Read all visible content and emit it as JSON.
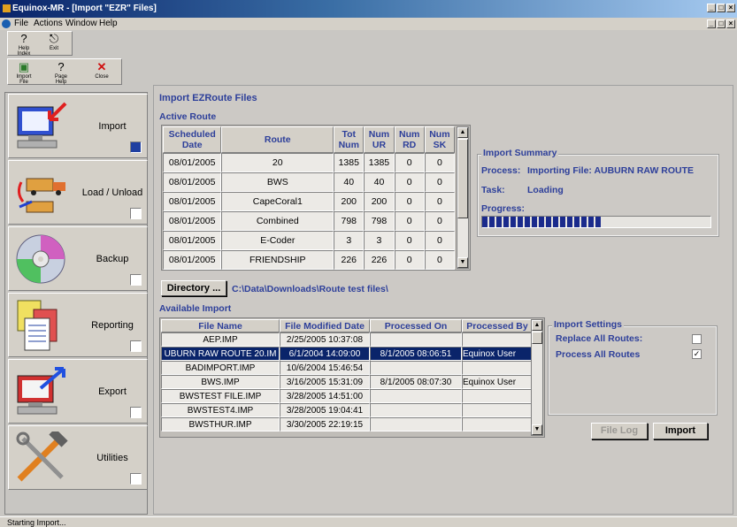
{
  "window": {
    "title": "Equinox-MR - [Import \"EZR\" Files]"
  },
  "menu": {
    "file": "File",
    "actions": "Actions",
    "window": "Window",
    "help": "Help"
  },
  "toolbar1": {
    "help_index": "Help Index",
    "exit": "Exit"
  },
  "toolbar2": {
    "import_file": "Import File",
    "page_help": "Page Help",
    "close": "Close"
  },
  "sidebar": {
    "items": [
      {
        "label": "Import",
        "checked": true
      },
      {
        "label": "Load / Unload",
        "checked": false
      },
      {
        "label": "Backup",
        "checked": false
      },
      {
        "label": "Reporting",
        "checked": false
      },
      {
        "label": "Export",
        "checked": false
      },
      {
        "label": "Utilities",
        "checked": false
      }
    ]
  },
  "main": {
    "heading": "Import EZRoute Files",
    "active_route_label": "Active Route",
    "routes_headers": {
      "scheduled_date": "Scheduled Date",
      "route": "Route",
      "tot_num": "Tot Num",
      "num_ur": "Num UR",
      "num_rd": "Num RD",
      "num_sk": "Num SK"
    },
    "routes": [
      {
        "date": "08/01/2005",
        "route": "20",
        "tot": "1385",
        "ur": "1385",
        "rd": "0",
        "sk": "0"
      },
      {
        "date": "08/01/2005",
        "route": "BWS",
        "tot": "40",
        "ur": "40",
        "rd": "0",
        "sk": "0"
      },
      {
        "date": "08/01/2005",
        "route": "CapeCoral1",
        "tot": "200",
        "ur": "200",
        "rd": "0",
        "sk": "0"
      },
      {
        "date": "08/01/2005",
        "route": "Combined",
        "tot": "798",
        "ur": "798",
        "rd": "0",
        "sk": "0"
      },
      {
        "date": "08/01/2005",
        "route": "E-Coder",
        "tot": "3",
        "ur": "3",
        "rd": "0",
        "sk": "0"
      },
      {
        "date": "08/01/2005",
        "route": "FRIENDSHIP",
        "tot": "226",
        "ur": "226",
        "rd": "0",
        "sk": "0"
      }
    ],
    "summary": {
      "title": "Import Summary",
      "process_label": "Process:",
      "process_value": "Importing File: AUBURN RAW ROUTE",
      "task_label": "Task:",
      "task_value": "Loading",
      "progress_label": "Progress:",
      "progress_fraction": 0.52
    },
    "directory_button": "Directory ...",
    "directory_path": "C:\\Data\\Downloads\\Route test files\\",
    "available_label": "Available Import",
    "files_headers": {
      "file_name": "File Name",
      "modified": "File Modified Date",
      "processed_on": "Processed On",
      "processed_by": "Processed By"
    },
    "files": [
      {
        "name": "AEP.IMP",
        "modified": "2/25/2005 10:37:08",
        "processed_on": "",
        "processed_by": ""
      },
      {
        "name": "UBURN RAW ROUTE 20.IM",
        "modified": "6/1/2004 14:09:00",
        "processed_on": "8/1/2005 08:06:51",
        "processed_by": "Equinox User"
      },
      {
        "name": "BADIMPORT.IMP",
        "modified": "10/6/2004 15:46:54",
        "processed_on": "",
        "processed_by": ""
      },
      {
        "name": "BWS.IMP",
        "modified": "3/16/2005 15:31:09",
        "processed_on": "8/1/2005 08:07:30",
        "processed_by": "Equinox User"
      },
      {
        "name": "BWSTEST FILE.IMP",
        "modified": "3/28/2005 14:51:00",
        "processed_on": "",
        "processed_by": ""
      },
      {
        "name": "BWSTEST4.IMP",
        "modified": "3/28/2005 19:04:41",
        "processed_on": "",
        "processed_by": ""
      },
      {
        "name": "BWSTHUR.IMP",
        "modified": "3/30/2005 22:19:15",
        "processed_on": "",
        "processed_by": ""
      }
    ],
    "selected_file_index": 1,
    "settings": {
      "title": "Import Settings",
      "replace_all": "Replace All Routes:",
      "replace_all_checked": false,
      "process_all": "Process All Routes",
      "process_all_checked": true
    },
    "file_log_button": "File Log",
    "import_button": "Import"
  },
  "status": {
    "text": "Starting Import..."
  },
  "colors": {
    "accent": "#2d3f9a",
    "selection": "#0a246a",
    "progress": "#1a2a8c"
  }
}
